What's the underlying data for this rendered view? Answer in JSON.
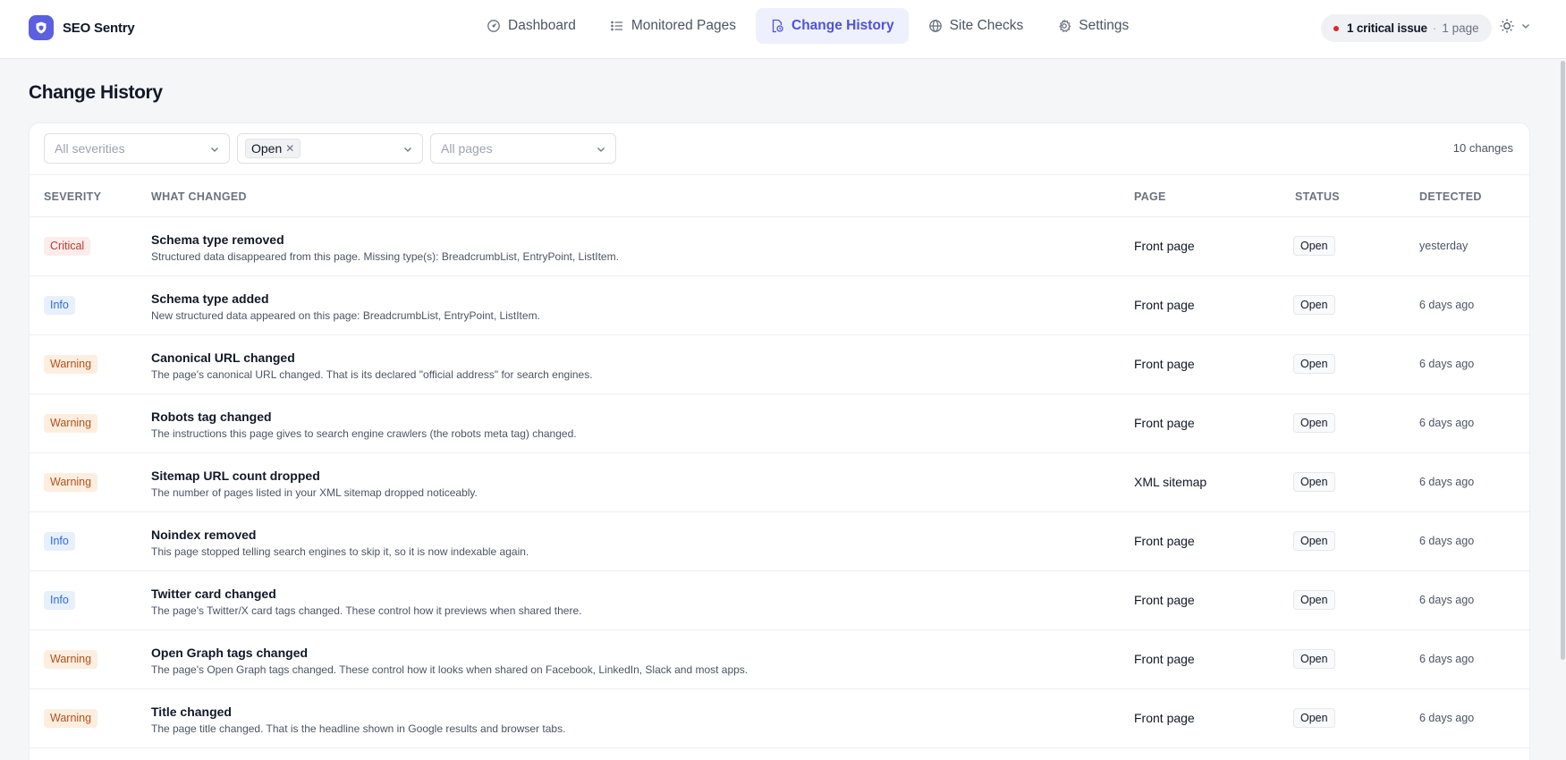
{
  "app": {
    "name": "SEO Sentry"
  },
  "nav": [
    {
      "label": "Dashboard",
      "icon": "gauge-icon",
      "active": false
    },
    {
      "label": "Monitored Pages",
      "icon": "list-icon",
      "active": false
    },
    {
      "label": "Change History",
      "icon": "history-doc-icon",
      "active": true
    },
    {
      "label": "Site Checks",
      "icon": "globe-icon",
      "active": false
    },
    {
      "label": "Settings",
      "icon": "gear-icon",
      "active": false
    }
  ],
  "issues": {
    "critical_text": "1 critical issue",
    "separator": "·",
    "pages_text": "1 page"
  },
  "page": {
    "title": "Change History"
  },
  "filters": {
    "severity_placeholder": "All severities",
    "status_tag": "Open",
    "status_remove": "✕",
    "pages_placeholder": "All pages",
    "count_text": "10 changes"
  },
  "table": {
    "headers": {
      "severity": "SEVERITY",
      "what": "WHAT CHANGED",
      "page": "PAGE",
      "status": "STATUS",
      "detected": "DETECTED"
    },
    "rows": [
      {
        "severity": "Critical",
        "level": "critical",
        "title": "Schema type removed",
        "desc": "Structured data disappeared from this page. Missing type(s): BreadcrumbList, EntryPoint, ListItem.",
        "page": "Front page",
        "status": "Open",
        "detected": "yesterday"
      },
      {
        "severity": "Info",
        "level": "info",
        "title": "Schema type added",
        "desc": "New structured data appeared on this page: BreadcrumbList, EntryPoint, ListItem.",
        "page": "Front page",
        "status": "Open",
        "detected": "6 days ago"
      },
      {
        "severity": "Warning",
        "level": "warning",
        "title": "Canonical URL changed",
        "desc": "The page's canonical URL changed. That is its declared \"official address\" for search engines.",
        "page": "Front page",
        "status": "Open",
        "detected": "6 days ago"
      },
      {
        "severity": "Warning",
        "level": "warning",
        "title": "Robots tag changed",
        "desc": "The instructions this page gives to search engine crawlers (the robots meta tag) changed.",
        "page": "Front page",
        "status": "Open",
        "detected": "6 days ago"
      },
      {
        "severity": "Warning",
        "level": "warning",
        "title": "Sitemap URL count dropped",
        "desc": "The number of pages listed in your XML sitemap dropped noticeably.",
        "page": "XML sitemap",
        "status": "Open",
        "detected": "6 days ago"
      },
      {
        "severity": "Info",
        "level": "info",
        "title": "Noindex removed",
        "desc": "This page stopped telling search engines to skip it, so it is now indexable again.",
        "page": "Front page",
        "status": "Open",
        "detected": "6 days ago"
      },
      {
        "severity": "Info",
        "level": "info",
        "title": "Twitter card changed",
        "desc": "The page's Twitter/X card tags changed. These control how it previews when shared there.",
        "page": "Front page",
        "status": "Open",
        "detected": "6 days ago"
      },
      {
        "severity": "Warning",
        "level": "warning",
        "title": "Open Graph tags changed",
        "desc": "The page's Open Graph tags changed. These control how it looks when shared on Facebook, LinkedIn, Slack and most apps.",
        "page": "Front page",
        "status": "Open",
        "detected": "6 days ago"
      },
      {
        "severity": "Warning",
        "level": "warning",
        "title": "Title changed",
        "desc": "The page title changed. That is the headline shown in Google results and browser tabs.",
        "page": "Front page",
        "status": "Open",
        "detected": "6 days ago"
      }
    ]
  },
  "colors": {
    "accent": "#5b5fe0",
    "critical": "#c0392b",
    "info": "#2f6bd6",
    "warning": "#b45218",
    "critical_dot": "#dc2626"
  }
}
